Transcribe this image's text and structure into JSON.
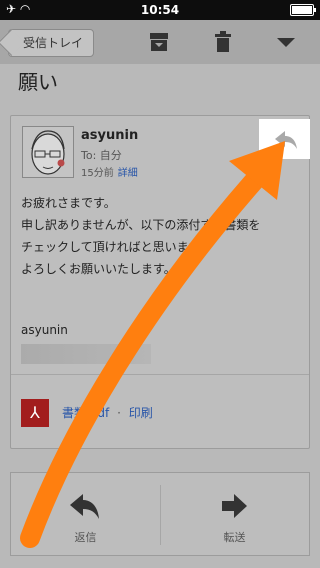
{
  "status": {
    "time": "10:54"
  },
  "toolbar": {
    "back_label": "受信トレイ"
  },
  "subject": "願い",
  "message": {
    "sender": "asyunin",
    "to": "To: 自分",
    "time": "15分前",
    "details_link": "詳細",
    "body": [
      "お疲れさまです。",
      "",
      "申し訳ありませんが、以下の添付する書類を",
      "チェックして頂ければと思います。",
      "よろしくお願いいたします。"
    ],
    "signature": "asyunin",
    "attachment": {
      "name": "書類.pdf",
      "separator": "·",
      "print_label": "印刷"
    }
  },
  "actions": {
    "reply_label": "返信",
    "forward_label": "転送"
  },
  "annotation": {
    "arrow_color": "#ff7f0f"
  }
}
